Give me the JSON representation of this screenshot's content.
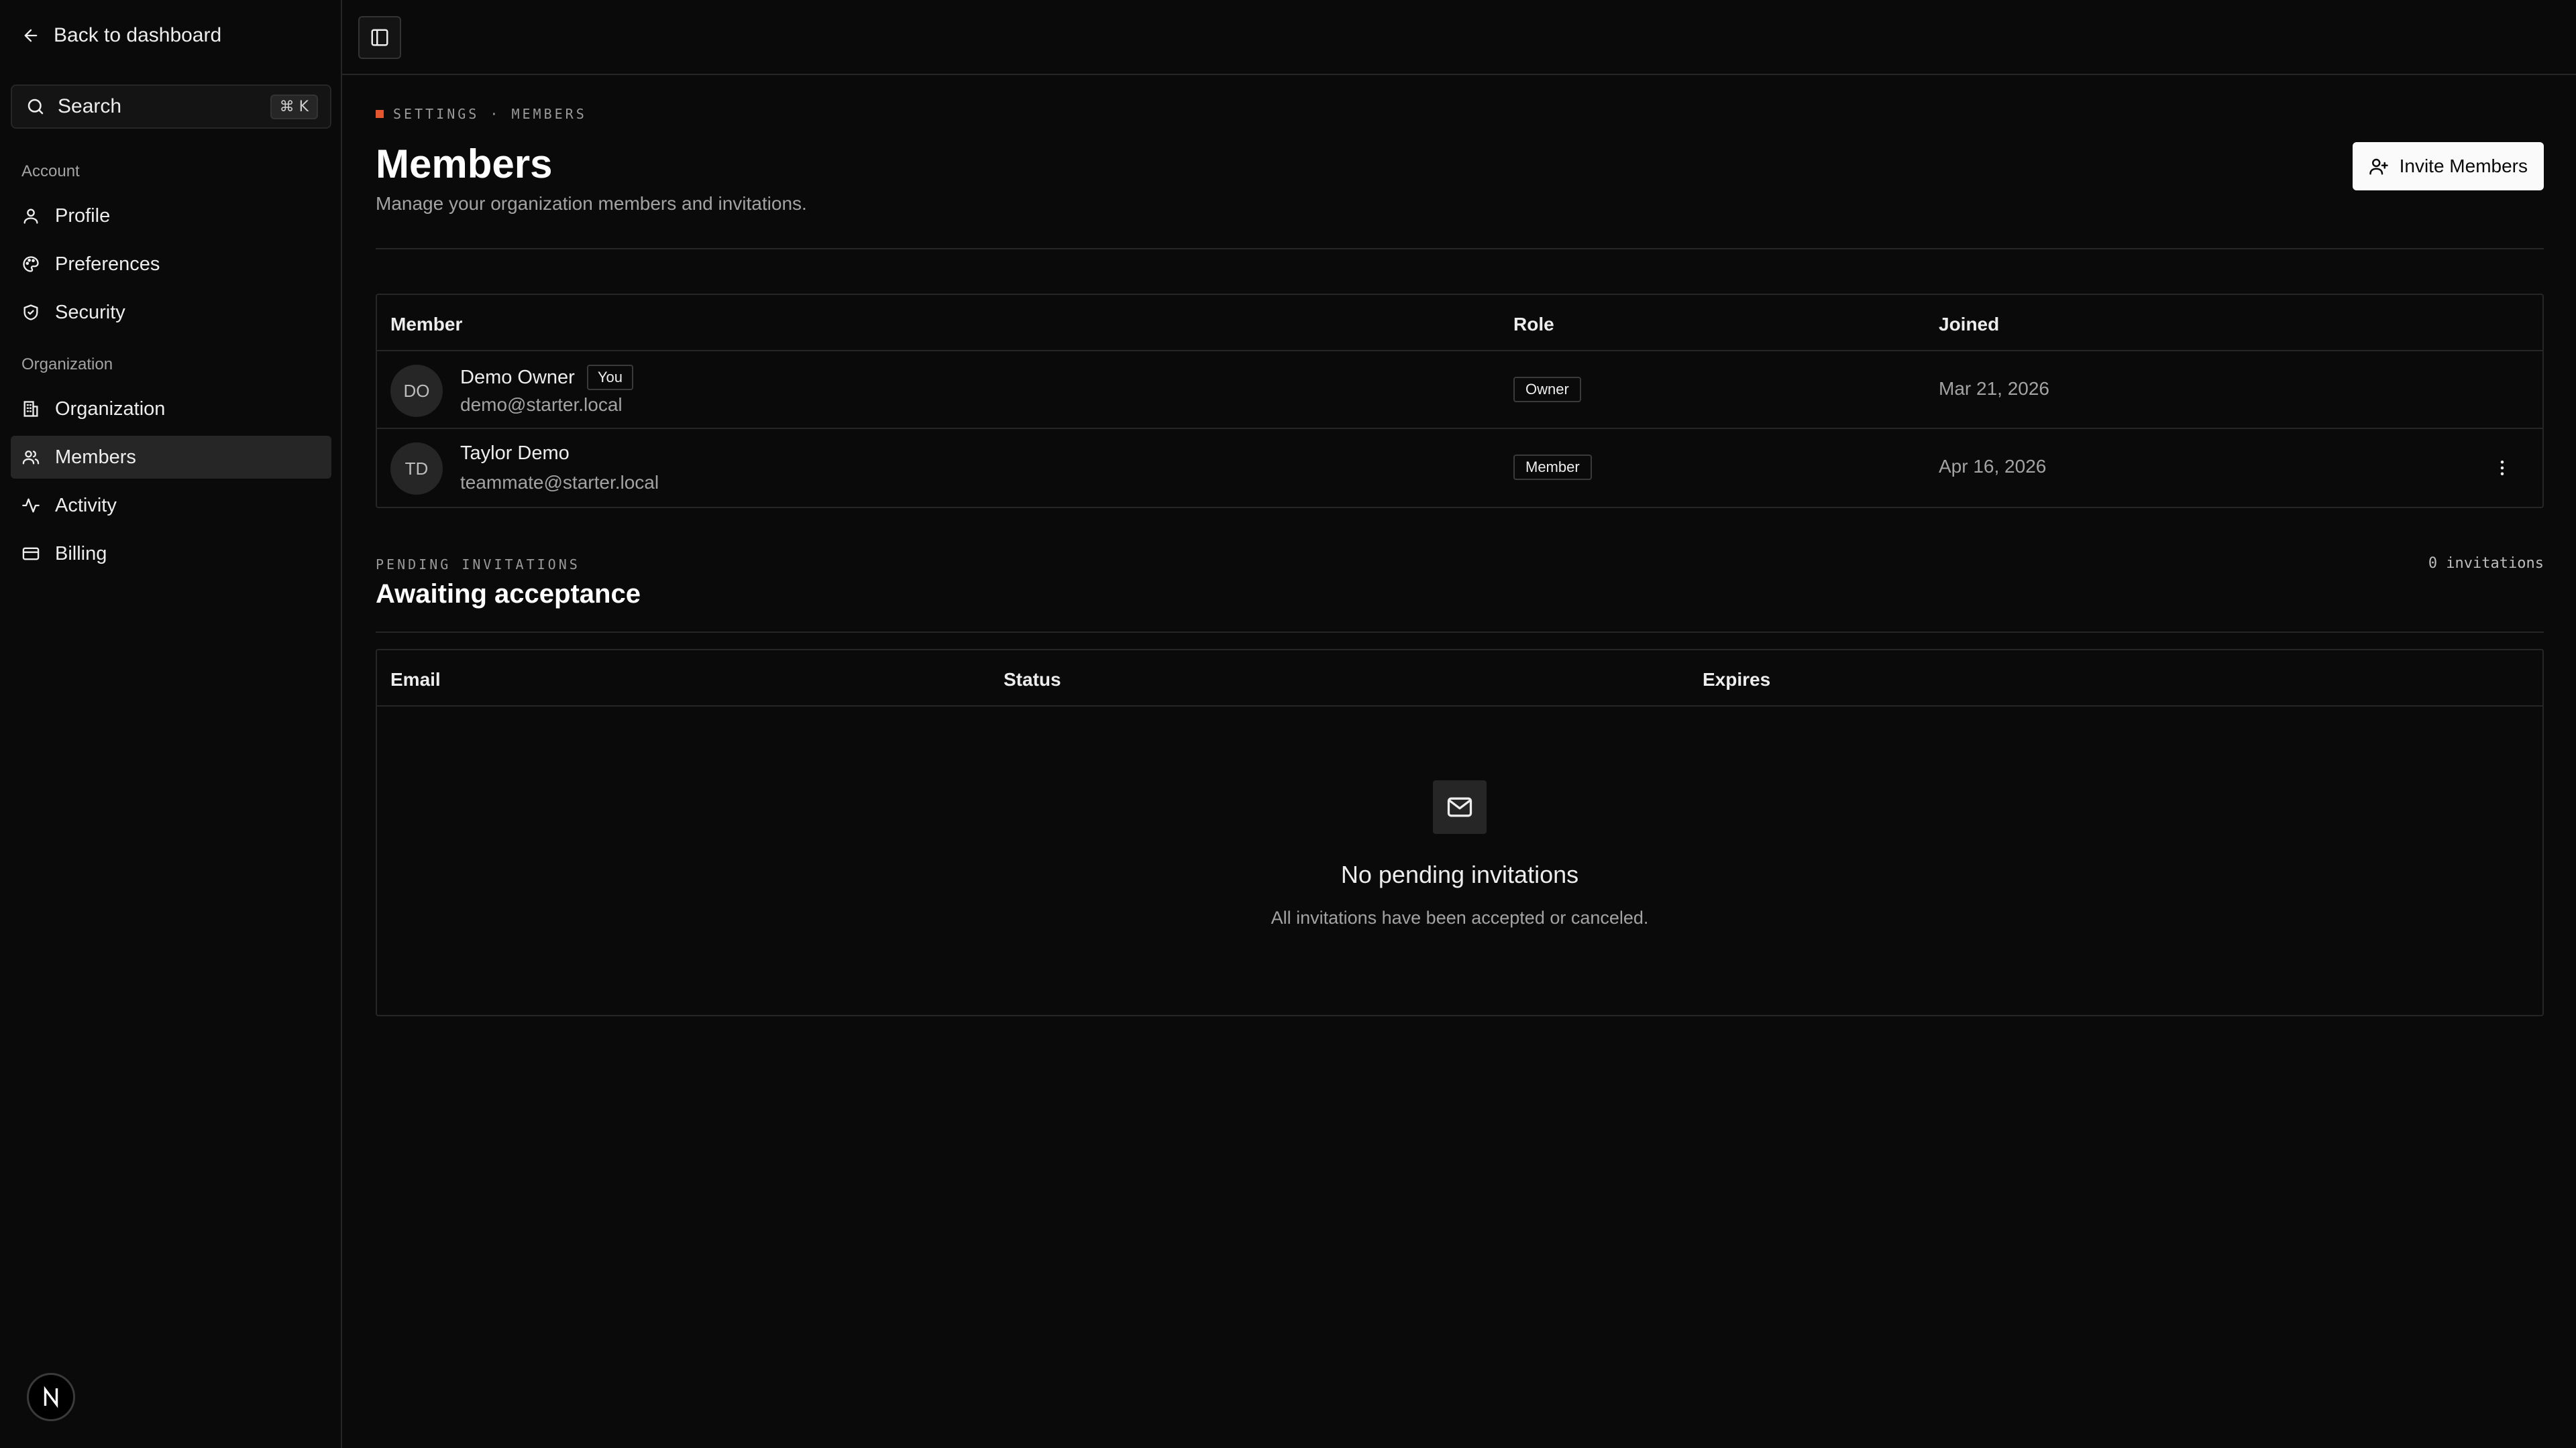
{
  "sidebar": {
    "back_label": "Back to dashboard",
    "search_label": "Search",
    "search_shortcut": "⌘ K",
    "sections": [
      {
        "title": "Account",
        "items": [
          {
            "label": "Profile",
            "icon": "user-icon"
          },
          {
            "label": "Preferences",
            "icon": "palette-icon"
          },
          {
            "label": "Security",
            "icon": "shield-icon"
          }
        ]
      },
      {
        "title": "Organization",
        "items": [
          {
            "label": "Organization",
            "icon": "building-icon"
          },
          {
            "label": "Members",
            "icon": "users-icon",
            "active": true
          },
          {
            "label": "Activity",
            "icon": "activity-icon"
          },
          {
            "label": "Billing",
            "icon": "credit-card-icon"
          }
        ]
      }
    ],
    "logo_letter": "N"
  },
  "breadcrumb": {
    "text": "SETTINGS · MEMBERS",
    "accent_color": "#e4572e"
  },
  "page": {
    "title": "Members",
    "subtitle": "Manage your organization members and invitations.",
    "invite_label": "Invite Members"
  },
  "members_table": {
    "columns": [
      "Member",
      "Role",
      "Joined"
    ],
    "rows": [
      {
        "initials": "DO",
        "name": "Demo Owner",
        "badge": "You",
        "email": "demo@starter.local",
        "role": "Owner",
        "joined": "Mar 21, 2026"
      },
      {
        "initials": "TD",
        "name": "Taylor Demo",
        "email": "teammate@starter.local",
        "role": "Member",
        "joined": "Apr 16, 2026"
      }
    ]
  },
  "pending": {
    "label": "PENDING INVITATIONS",
    "count": "0 invitations",
    "title": "Awaiting acceptance",
    "columns": [
      "Email",
      "Status",
      "Expires"
    ],
    "empty_title": "No pending invitations",
    "empty_subtitle": "All invitations have been accepted or canceled."
  },
  "colors": {
    "background": "#0a0a0a",
    "border": "#262626",
    "accent": "#e4572e"
  }
}
